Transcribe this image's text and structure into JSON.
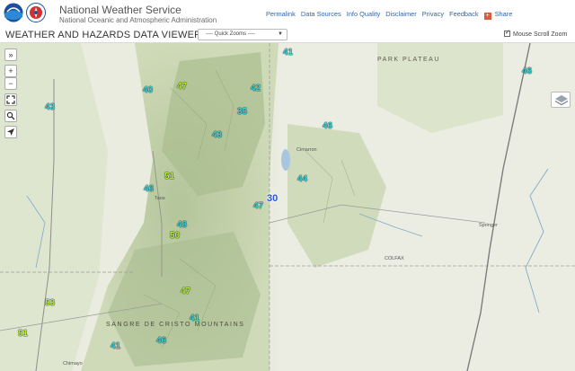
{
  "header": {
    "agency_name": "National Weather Service",
    "agency_sub": "National Oceanic and Atmospheric Administration",
    "links": [
      "Permalink",
      "Data Sources",
      "Info Quality",
      "Disclaimer",
      "Privacy",
      "Feedback"
    ],
    "share_label": "Share"
  },
  "toolbar": {
    "title": "WEATHER AND HAZARDS DATA VIEWER",
    "quick_zooms": "---- Quick Zooms ----",
    "scroll_zoom_label": "Mouse Scroll Zoom",
    "scroll_zoom_checked": true
  },
  "map_controls": {
    "expand": "»",
    "zoom_in": "+",
    "zoom_out": "−"
  },
  "map_labels": {
    "park_plateau": "PARK PLATEAU",
    "sangre": "SANGRE DE CRISTO MOUNTAINS",
    "taos": "Taos",
    "springer": "Springer",
    "colfax": "COLFAX",
    "chimayo": "Chimayo",
    "cimarron": "Cimarron"
  },
  "temperatures": [
    {
      "value": "41",
      "color": "cyan"
    },
    {
      "value": "46",
      "color": "cyan"
    },
    {
      "value": "40",
      "color": "cyan"
    },
    {
      "value": "47",
      "color": "green"
    },
    {
      "value": "42",
      "color": "cyan"
    },
    {
      "value": "43",
      "color": "cyan"
    },
    {
      "value": "35",
      "color": "cyan"
    },
    {
      "value": "46",
      "color": "cyan"
    },
    {
      "value": "43",
      "color": "cyan"
    },
    {
      "value": "51",
      "color": "green"
    },
    {
      "value": "46",
      "color": "cyan"
    },
    {
      "value": "44",
      "color": "cyan"
    },
    {
      "value": "30",
      "color": "blue"
    },
    {
      "value": "47",
      "color": "cyan"
    },
    {
      "value": "48",
      "color": "cyan"
    },
    {
      "value": "50",
      "color": "green"
    },
    {
      "value": "47",
      "color": "green"
    },
    {
      "value": "53",
      "color": "green"
    },
    {
      "value": "41",
      "color": "cyan"
    },
    {
      "value": "51",
      "color": "green"
    },
    {
      "value": "46",
      "color": "cyan"
    },
    {
      "value": "41",
      "color": "cyan"
    }
  ]
}
